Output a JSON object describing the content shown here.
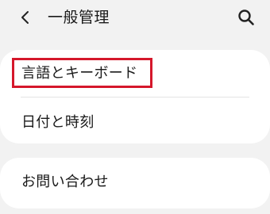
{
  "header": {
    "title": "一般管理",
    "back_icon": "chevron-left-icon",
    "search_icon": "search-icon"
  },
  "list": {
    "group1": [
      {
        "label": "言語とキーボード",
        "highlighted": true
      },
      {
        "label": "日付と時刻"
      }
    ],
    "group2": [
      {
        "label": "お問い合わせ"
      }
    ]
  },
  "colors": {
    "background": "#f2f2f2",
    "card": "#ffffff",
    "highlight": "#d5172b"
  }
}
